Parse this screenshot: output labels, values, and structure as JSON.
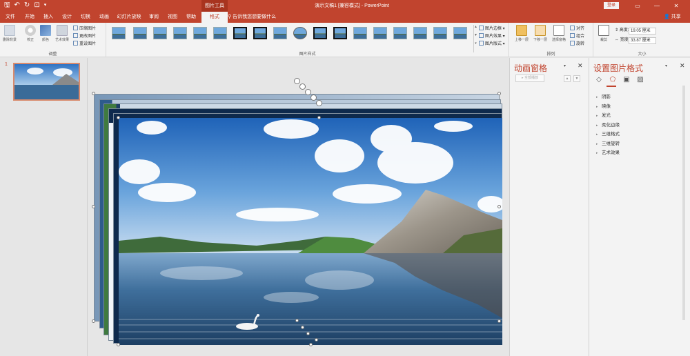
{
  "app": {
    "window_title": "演示文稿1 [兼容模式] - PowerPoint",
    "context_tab_group": "图片工具",
    "login_label": "登录",
    "share_label": "共享",
    "tell_me_placeholder": "告诉我您想要做什么"
  },
  "tabs": [
    {
      "label": "文件",
      "active": false
    },
    {
      "label": "开始",
      "active": false
    },
    {
      "label": "插入",
      "active": false
    },
    {
      "label": "设计",
      "active": false
    },
    {
      "label": "切换",
      "active": false
    },
    {
      "label": "动画",
      "active": false
    },
    {
      "label": "幻灯片放映",
      "active": false
    },
    {
      "label": "审阅",
      "active": false
    },
    {
      "label": "视图",
      "active": false
    },
    {
      "label": "帮助",
      "active": false
    },
    {
      "label": "格式",
      "active": true
    }
  ],
  "ribbon": {
    "adjust": {
      "label": "调整",
      "remove_bg": "删除背景",
      "corrections": "校正",
      "color": "颜色",
      "artistic": "艺术效果",
      "compress": "压缩图片",
      "change": "更改图片",
      "reset": "重设图片"
    },
    "styles": {
      "label": "图片样式",
      "border": "图片边框",
      "effects": "图片效果",
      "layout": "图片版式"
    },
    "arrange": {
      "label": "排列",
      "bring_forward": "上移一层",
      "send_backward": "下移一层",
      "selection_pane": "选择窗格",
      "align": "对齐",
      "group": "组合",
      "rotate": "旋转"
    },
    "size": {
      "label": "大小",
      "crop": "裁剪",
      "height_label": "高度:",
      "height_value": "19.05 厘米",
      "width_label": "宽度:",
      "width_value": "33.87 厘米"
    }
  },
  "slides": [
    {
      "number": "1"
    }
  ],
  "animation_pane": {
    "title": "动画窗格",
    "play_all": "全部播放"
  },
  "format_pane": {
    "title": "设置图片格式",
    "items": [
      "阴影",
      "映像",
      "发光",
      "柔化边缘",
      "三维格式",
      "三维旋转",
      "艺术效果"
    ]
  },
  "colors": {
    "accent": "#c1442e",
    "ribbon_bg": "#f3f3f3",
    "workspace_bg": "#e6e6e6"
  }
}
